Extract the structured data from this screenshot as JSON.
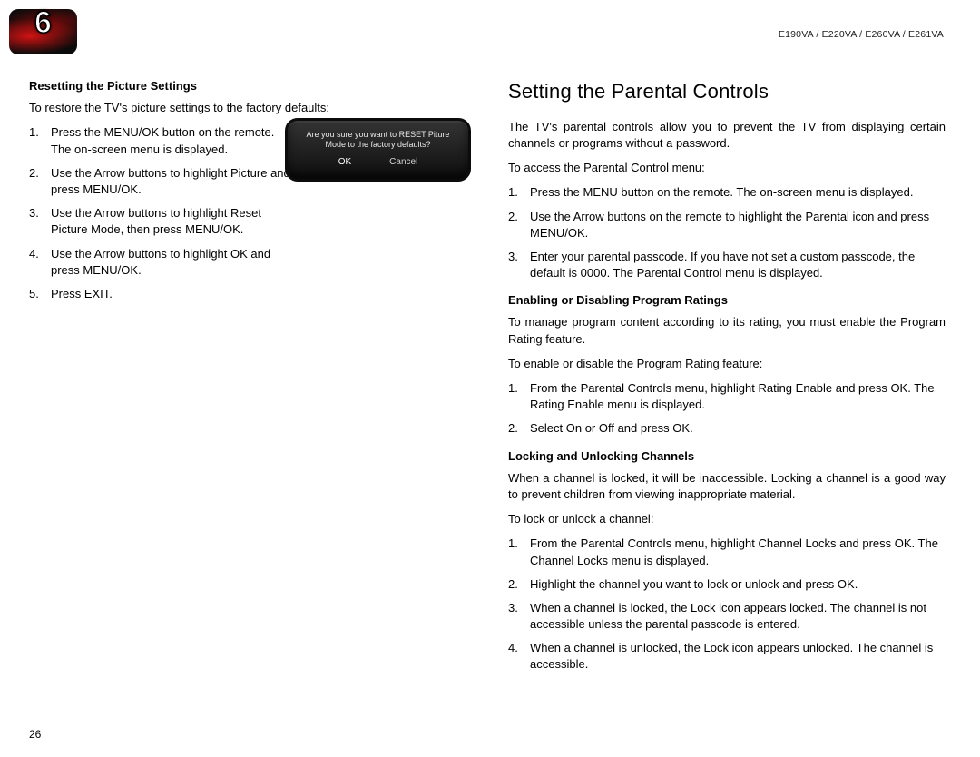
{
  "chapter_number": "6",
  "header_models": "E190VA / E220VA / E260VA / E261VA",
  "page_number": "26",
  "left": {
    "subhead": "Resetting the Picture Settings",
    "intro": "To restore the TV's picture settings to the factory defaults:",
    "steps": [
      "Press the MENU/OK button on the remote. The on-screen menu is displayed.",
      "Use the Arrow buttons to highlight Picture and press MENU/OK.",
      "Use the Arrow buttons to highlight Reset Picture Mode, then press MENU/OK.",
      "Use the Arrow buttons to highlight OK and press MENU/OK.",
      "Press EXIT."
    ],
    "dialog": {
      "message": "Are you sure you want to RESET Piture\nMode to the factory defaults?",
      "ok": "OK",
      "cancel": "Cancel"
    }
  },
  "right": {
    "section_title": "Setting the Parental Controls",
    "intro": "The TV's parental controls allow you to prevent the TV from displaying certain channels or programs without a password.",
    "access_intro": "To access the Parental Control menu:",
    "access_steps": [
      "Press the MENU button on the remote. The on-screen menu is displayed.",
      "Use the Arrow buttons on the remote to highlight the Parental icon and press MENU/OK.",
      "Enter your parental passcode. If you have not set a custom passcode, the default is 0000. The Parental Control menu is displayed."
    ],
    "sub1": {
      "head": "Enabling or Disabling Program Ratings",
      "p1": "To manage program content according to its rating, you must enable the Program Rating feature.",
      "p2": "To enable or disable the Program Rating feature:",
      "steps": [
        "From the Parental Controls menu, highlight Rating Enable and press OK. The Rating Enable menu is displayed.",
        "Select On or Off and press OK."
      ]
    },
    "sub2": {
      "head": "Locking and Unlocking Channels",
      "p1": "When a channel is locked, it will be inaccessible. Locking a channel is a good way to prevent children from viewing inappropriate material.",
      "p2": "To lock or unlock a channel:",
      "steps": [
        "From the Parental Controls menu, highlight Channel Locks and press OK. The Channel Locks menu is displayed.",
        "Highlight the channel you want to lock or unlock and press OK.",
        "When a channel is locked, the Lock icon appears locked. The channel is not accessible unless the parental passcode is entered.",
        "When a channel is unlocked, the Lock icon appears unlocked. The channel is accessible."
      ]
    }
  }
}
